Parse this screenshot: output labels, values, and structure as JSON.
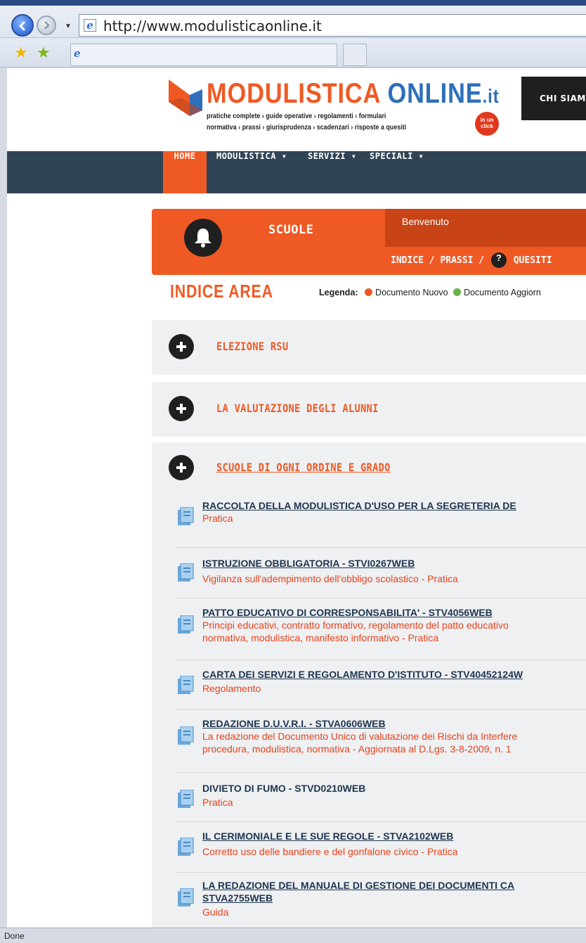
{
  "browser": {
    "url": "http://www.modulisticaonline.it",
    "status": "Done"
  },
  "site": {
    "logo_part1": "MODULISTICA",
    "logo_part2": "ONLINE",
    "logo_part3": ".it",
    "tagline1": "pratiche complete › guide operative › regolamenti › formulari",
    "tagline2": "normativa › prassi › giurisprudenza › scadenzari › risposte a quesiti",
    "oneclick_line1": "in un",
    "oneclick_line2": "click",
    "chi_siamo": "CHI SIAM",
    "accent": "#ef5a24",
    "nav_bg": "#2f4556"
  },
  "nav": {
    "home": "HOME",
    "modulistica": "MODULISTICA ▾",
    "servizi": "SERVIZI ▾",
    "speciali": "SPECIALI ▾"
  },
  "banner": {
    "section": "SCUOLE",
    "welcome": "Benvenuto",
    "crumb_indice": "INDICE",
    "crumb_sep1": " / ",
    "crumb_prassi": "PRASSI",
    "crumb_sep2": " / ",
    "crumb_q": "?",
    "crumb_quesiti": "QUESITI"
  },
  "indice": {
    "title": "INDICE AREA",
    "legenda_label": "Legenda:",
    "legenda_new": "Documento Nuovo",
    "legenda_upd": "Documento Aggiorn"
  },
  "sections": [
    {
      "title": "ELEZIONE RSU"
    },
    {
      "title": "LA VALUTAZIONE DEGLI ALUNNI"
    },
    {
      "title": "SCUOLE DI OGNI ORDINE E GRADO"
    }
  ],
  "documents": [
    {
      "title": "RACCOLTA DELLA MODULISTICA D'USO PER LA SEGRETERIA DE",
      "desc": "Pratica"
    },
    {
      "title": "ISTRUZIONE OBBLIGATORIA - STVI0267WEB",
      "desc": "Vigilanza sull'adempimento dell'obbligo scolastico - Pratica"
    },
    {
      "title": "PATTO EDUCATIVO DI CORRESPONSABILITA' - STV4056WEB",
      "desc": "Principi educativi, contratto formativo, regolamento del patto educativo",
      "desc2": "normativa, modulistica, manifesto informativo - Pratica"
    },
    {
      "title": "CARTA DEI SERVIZI E REGOLAMENTO D'ISTITUTO - STV40452124W",
      "desc": "Regolamento"
    },
    {
      "title": "REDAZIONE D.U.V.R.I. - STVA0606WEB",
      "desc": "La redazione del Documento Unico di valutazione dei Rischi da Interfere",
      "desc2": "procedura, modulistica, normativa - Aggiornata al D.Lgs. 3-8-2009, n. 1"
    },
    {
      "title": "DIVIETO DI FUMO - STVD0210WEB",
      "desc": "Pratica"
    },
    {
      "title": "IL CERIMONIALE E LE SUE REGOLE - STVA2102WEB",
      "desc": "Corretto uso delle bandiere e del gonfalone civico - Pratica"
    },
    {
      "title": "LA REDAZIONE DEL MANUALE DI GESTIONE DEI DOCUMENTI CA",
      "title2": "STVA2755WEB",
      "desc": "Guida"
    }
  ]
}
